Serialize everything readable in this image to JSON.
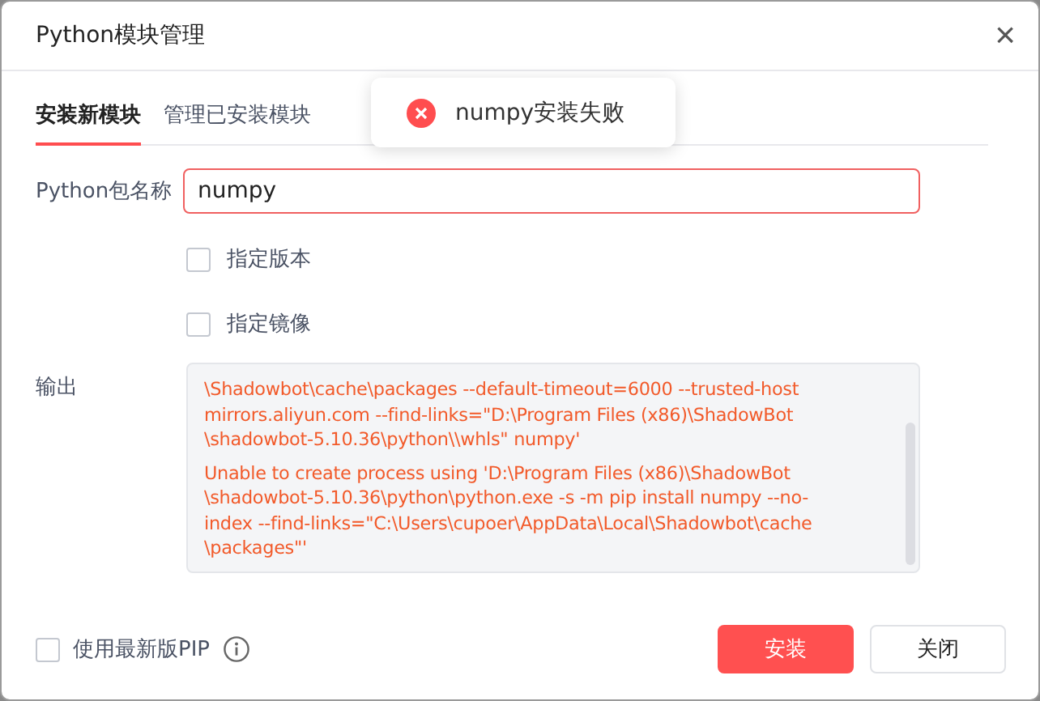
{
  "window": {
    "title": "Python模块管理",
    "close": "×"
  },
  "tabs": [
    {
      "label": "安装新模块",
      "selected": true
    },
    {
      "label": "管理已安装模块",
      "selected": false
    }
  ],
  "toast": {
    "kind": "error",
    "message": "numpy安装失败"
  },
  "package_field": {
    "label": "Python包名称",
    "value": "numpy",
    "error": true
  },
  "options": [
    {
      "label": "指定版本",
      "checked": false
    },
    {
      "label": "指定镜像",
      "checked": false
    }
  ],
  "output": {
    "label": "输出",
    "paragraphs": [
      [
        "\\Shadowbot\\cache\\packages --default-timeout=6000 --trusted-host",
        "mirrors.aliyun.com --find-links=\"D:\\Program Files (x86)\\ShadowBot",
        "\\shadowbot-5.10.36\\python\\\\whls\" numpy'"
      ],
      [
        "Unable to create process using 'D:\\Program Files (x86)\\ShadowBot",
        "\\shadowbot-5.10.36\\python\\python.exe -s -m pip install numpy --no-",
        "index --find-links=\"C:\\Users\\cupoer\\AppData\\Local\\Shadowbot\\cache",
        "\\packages\"'"
      ]
    ]
  },
  "latest_pip": {
    "label": "使用最新版PIP",
    "checked": false
  },
  "buttons": [
    {
      "label": "安装",
      "kind": "primary"
    },
    {
      "label": "关闭",
      "kind": "default"
    }
  ]
}
